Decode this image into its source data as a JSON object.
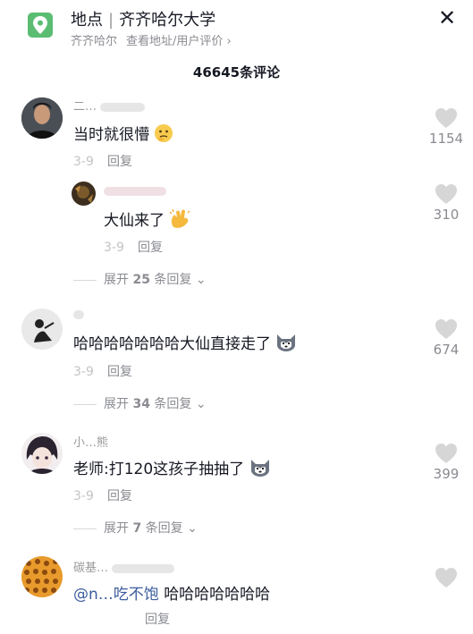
{
  "header": {
    "location_label": "地点",
    "location_name": "齐齐哈尔大学",
    "city": "齐齐哈尔",
    "address_link": "查看地址/用户评价",
    "close_symbol": "✕"
  },
  "comment_count": "46645条评论",
  "comments": [
    {
      "user": "二…",
      "text": "当时就很懵",
      "emoji": "thinking-emoji",
      "reply": "回复",
      "likes": "1154",
      "sub_reply": {
        "user": "",
        "text": "大仙来了",
        "emoji": "clapping-emoji",
        "reply": "回复",
        "likes": "310"
      },
      "expand": {
        "prefix": "展开",
        "count": "25",
        "suffix": "条回复"
      }
    },
    {
      "user": "",
      "text": "哈哈哈哈哈哈哈大仙直接走了",
      "emoji": "husky-emoji",
      "reply": "回复",
      "likes": "674",
      "expand": {
        "prefix": "展开",
        "count": "34",
        "suffix": "条回复"
      }
    },
    {
      "user": "小…熊",
      "text": "老师:打120这孩子抽抽了",
      "emoji": "husky-emoji",
      "reply": "回复",
      "likes": "399",
      "expand": {
        "prefix": "展开",
        "count": "7",
        "suffix": "条回复"
      }
    },
    {
      "user": "碳基…",
      "mention": "@n…吃不饱",
      "text": "哈哈哈哈哈哈哈",
      "reply": "回复"
    }
  ],
  "colors": {
    "accent_green": "#5bbd72",
    "muted": "#8a8b91",
    "mention": "#3b5c9c"
  }
}
